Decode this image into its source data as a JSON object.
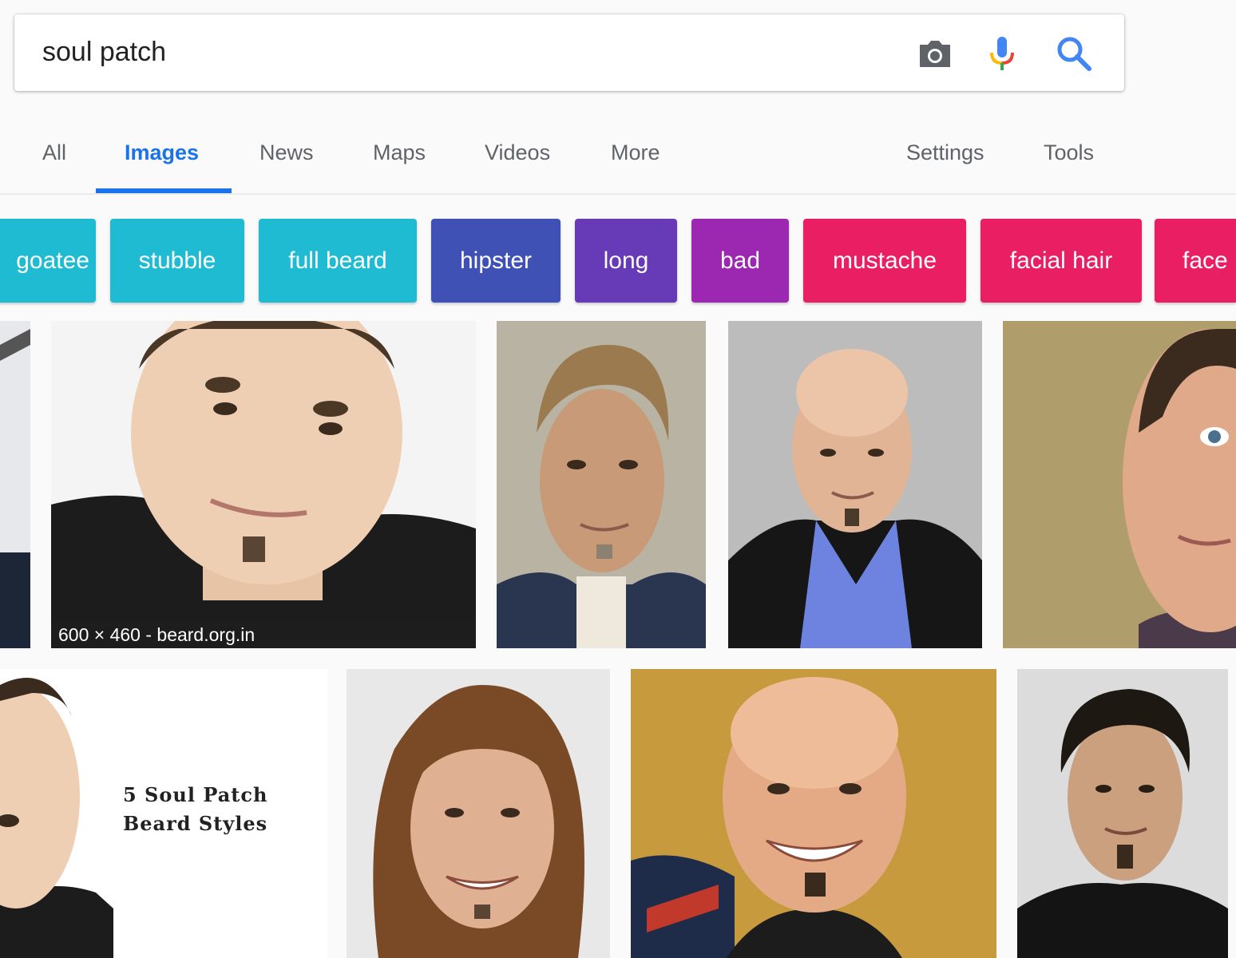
{
  "search": {
    "query": "soul patch",
    "icons": [
      "camera-icon",
      "microphone-icon",
      "search-icon"
    ],
    "accent": "#4285f4"
  },
  "tabs": {
    "left": [
      "All",
      "Images",
      "News",
      "Maps",
      "Videos",
      "More"
    ],
    "right": [
      "Settings",
      "Tools"
    ],
    "active": "Images",
    "active_color": "#1a73e8"
  },
  "chips": [
    {
      "label": "goatee",
      "color": "#1fbbd2"
    },
    {
      "label": "stubble",
      "color": "#1fbbd2"
    },
    {
      "label": "full beard",
      "color": "#1fbbd2"
    },
    {
      "label": "hipster",
      "color": "#3f51b5"
    },
    {
      "label": "long",
      "color": "#673ab7"
    },
    {
      "label": "bad",
      "color": "#9c27b0"
    },
    {
      "label": "mustache",
      "color": "#e91e63"
    },
    {
      "label": "facial hair",
      "color": "#e91e63"
    },
    {
      "label": "face",
      "color": "#e91e63"
    }
  ],
  "results": {
    "row1": [
      {
        "kind": "partial-image"
      },
      {
        "kind": "portrait",
        "caption": "600 × 460 - beard.org.in"
      },
      {
        "kind": "portrait"
      },
      {
        "kind": "portrait"
      },
      {
        "kind": "portrait"
      }
    ],
    "row2": [
      {
        "kind": "portrait",
        "overlay_lines": [
          "5 Soul Patch",
          "Beard Styles"
        ]
      },
      {
        "kind": "portrait"
      },
      {
        "kind": "portrait"
      },
      {
        "kind": "portrait"
      }
    ]
  }
}
